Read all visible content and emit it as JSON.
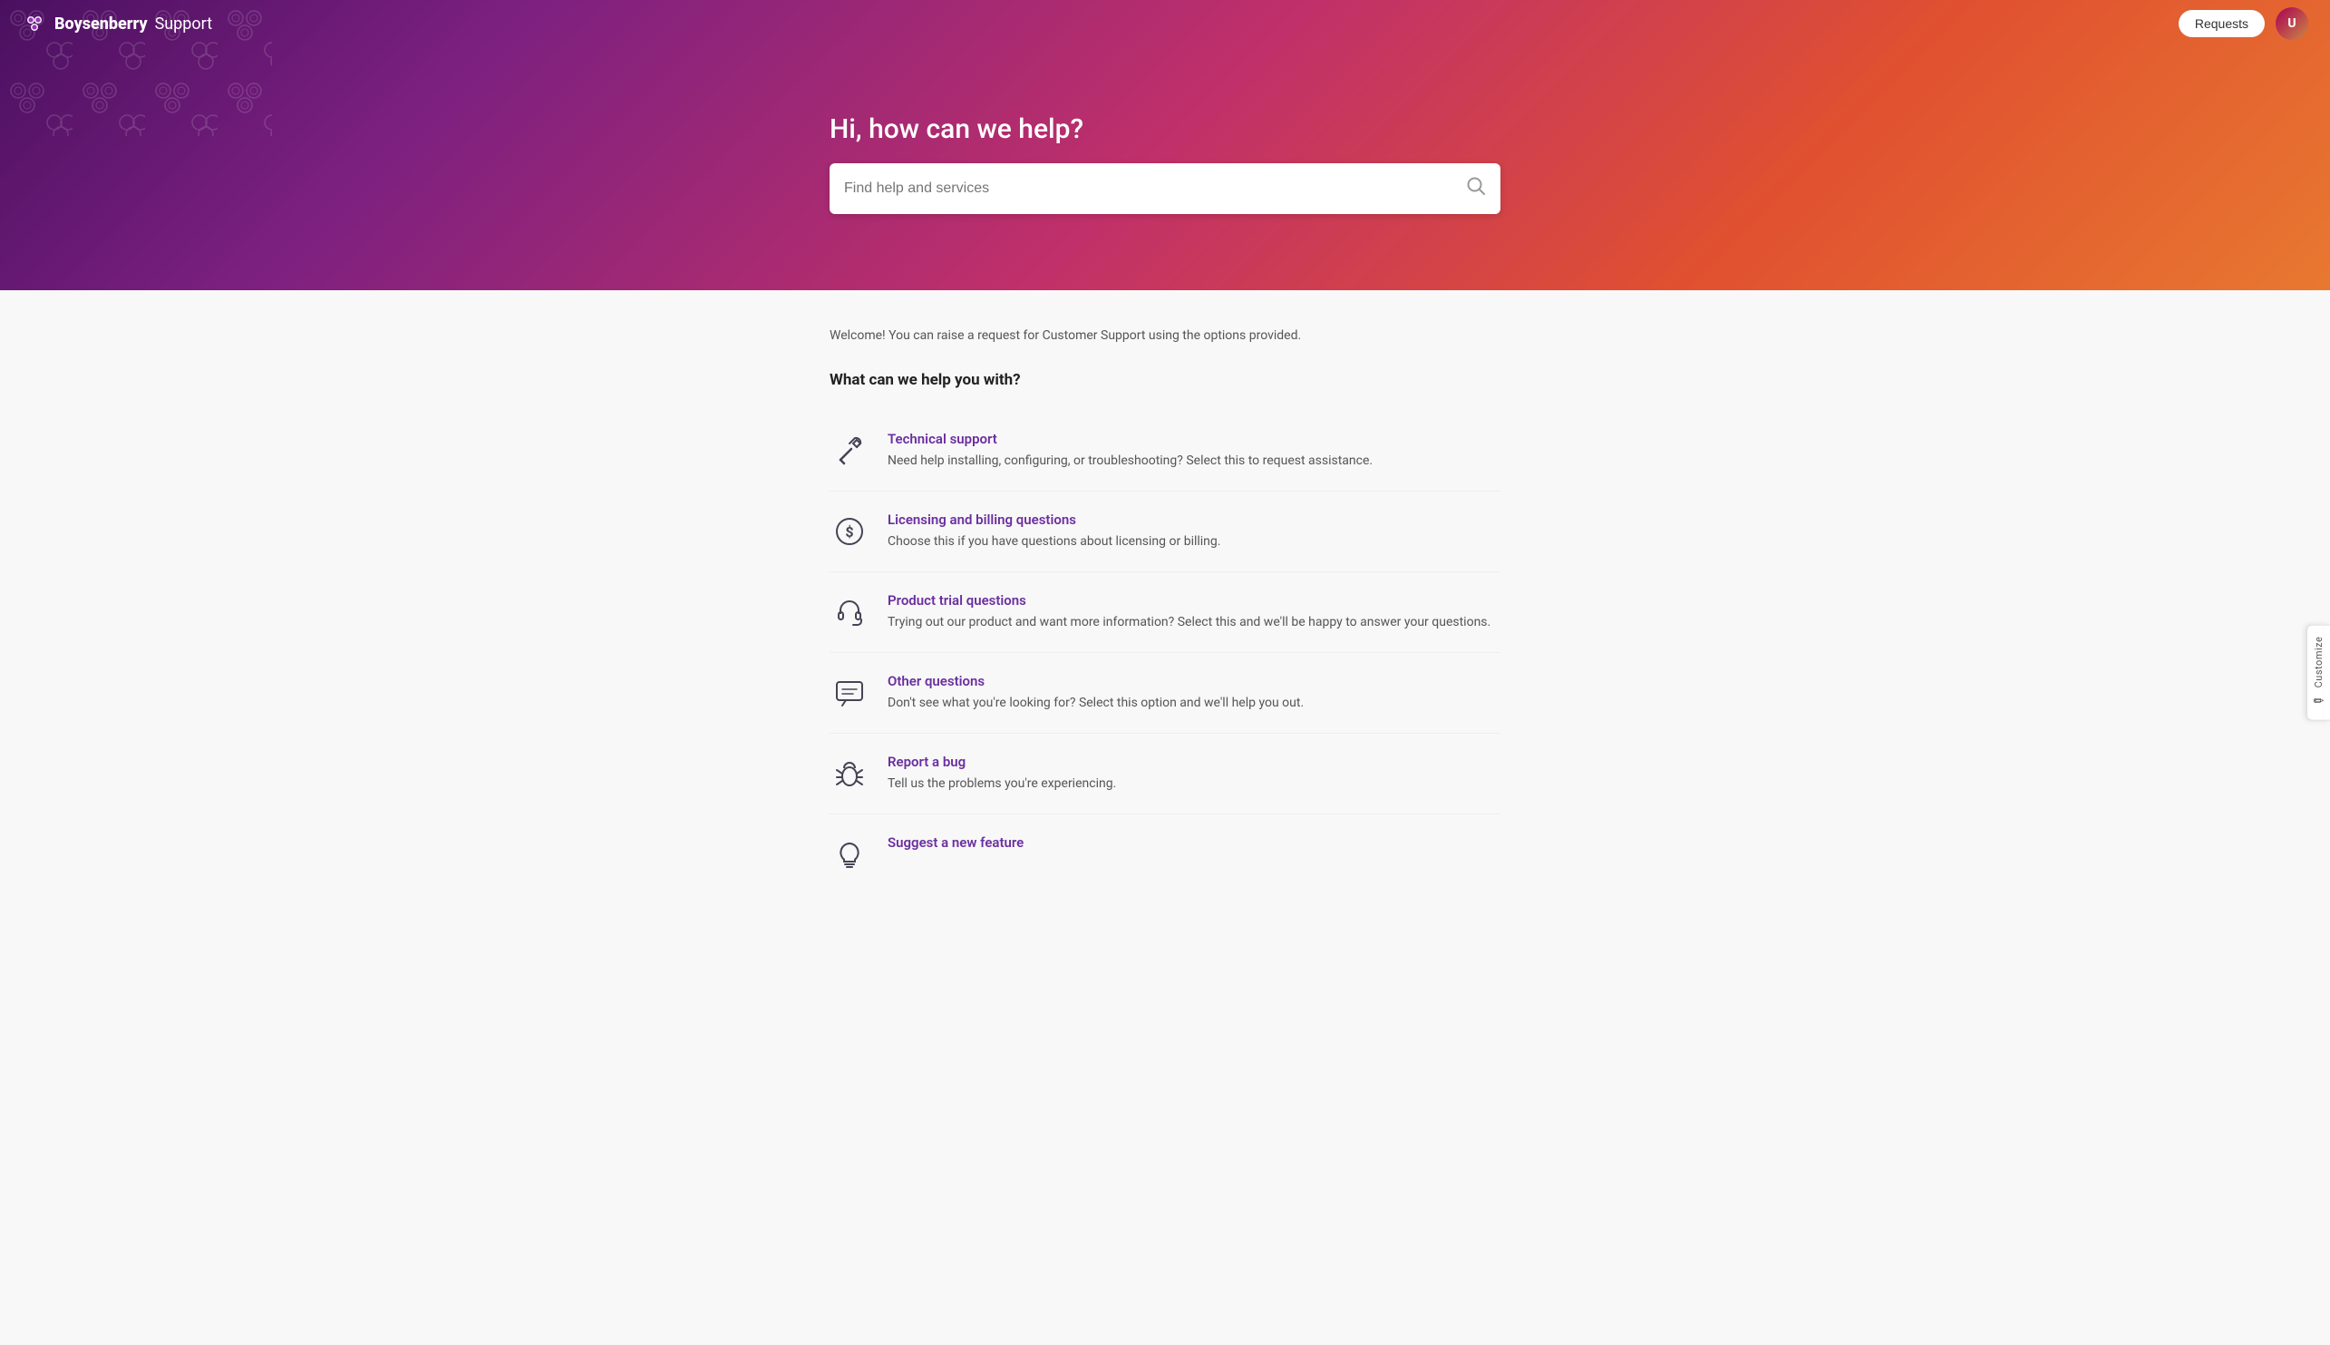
{
  "header": {
    "logo_brand": "Boysenberry",
    "logo_support": " Support",
    "requests_label": "Requests"
  },
  "hero": {
    "title": "Hi, how can we help?",
    "search_placeholder": "Find help and services"
  },
  "customize": {
    "label": "Customize",
    "icon": "✏"
  },
  "main": {
    "welcome": "Welcome! You can raise a request for Customer Support using the options provided.",
    "section_title": "What can we help you with?",
    "services": [
      {
        "id": "technical-support",
        "title": "Technical support",
        "desc": "Need help installing, configuring, or troubleshooting? Select this to request assistance.",
        "icon": "wrench"
      },
      {
        "id": "licensing-billing",
        "title": "Licensing and billing questions",
        "desc": "Choose this if you have questions about licensing or billing.",
        "icon": "dollar"
      },
      {
        "id": "product-trial",
        "title": "Product trial questions",
        "desc": "Trying out our product and want more information? Select this and we'll be happy to answer your questions.",
        "icon": "headset"
      },
      {
        "id": "other-questions",
        "title": "Other questions",
        "desc": "Don't see what you're looking for? Select this option and we'll help you out.",
        "icon": "chat"
      },
      {
        "id": "report-bug",
        "title": "Report a bug",
        "desc": "Tell us the problems you're experiencing.",
        "icon": "bug"
      },
      {
        "id": "suggest-feature",
        "title": "Suggest a new feature",
        "desc": "",
        "icon": "lightbulb"
      }
    ]
  }
}
